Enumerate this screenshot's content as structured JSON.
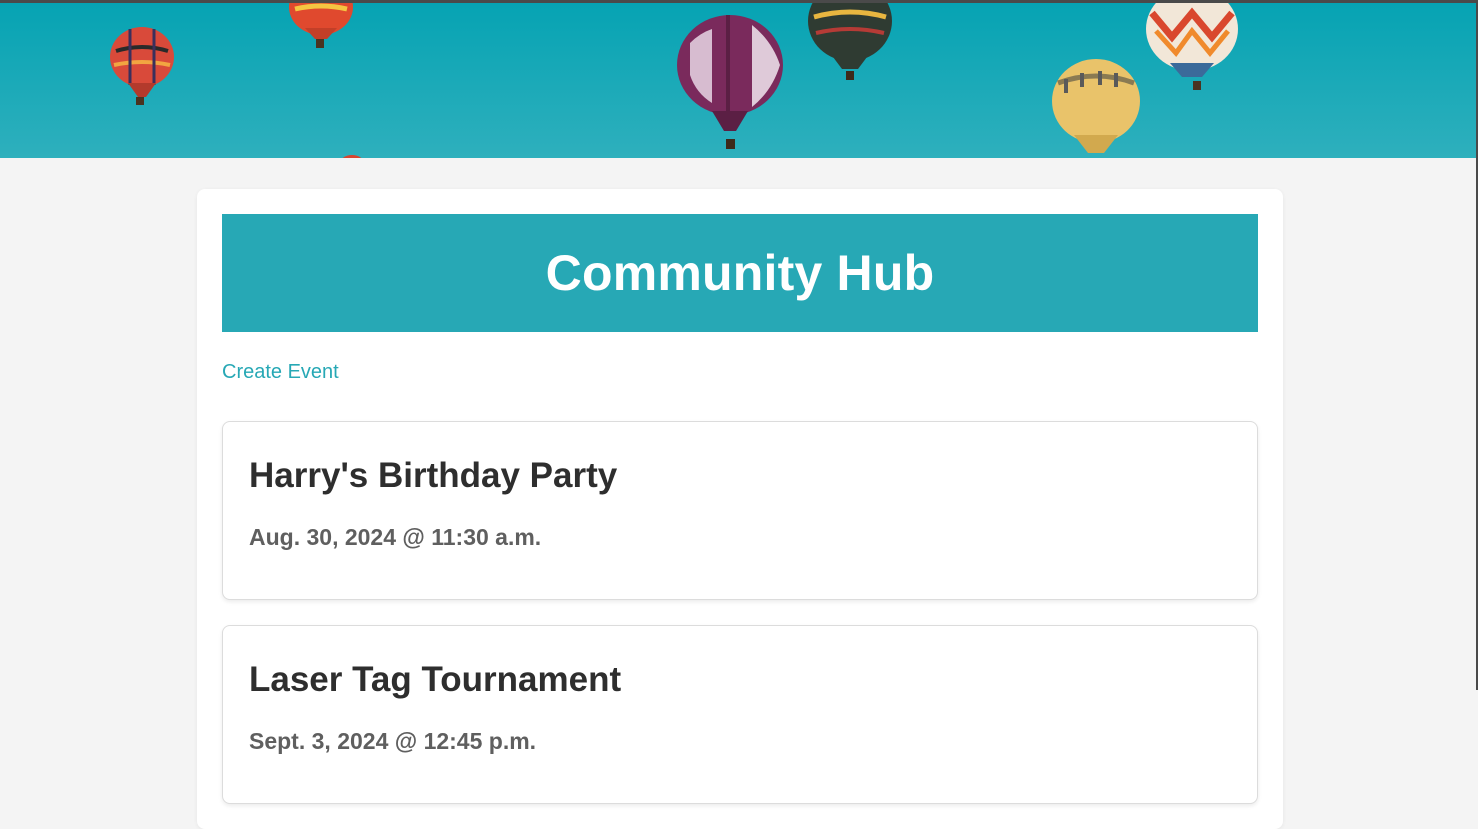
{
  "header": {
    "title": "Community Hub"
  },
  "nav": {
    "create_event_label": "Create Event"
  },
  "events": [
    {
      "title": "Harry's Birthday Party",
      "date": "Aug. 30, 2024 @ 11:30 a.m."
    },
    {
      "title": "Laser Tag Tournament",
      "date": "Sept. 3, 2024 @ 12:45 p.m."
    }
  ],
  "colors": {
    "accent": "#27a8b5",
    "sky": "#1fa9b8",
    "page_background": "#f4f4f4"
  },
  "hero": {
    "image": "hot-air-balloons-banner"
  }
}
